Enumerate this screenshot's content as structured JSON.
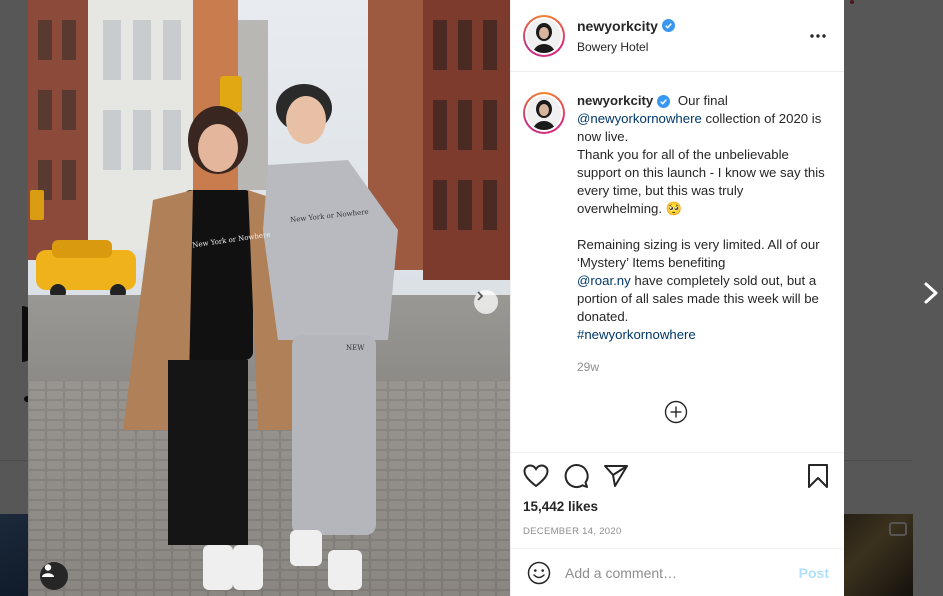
{
  "post": {
    "username": "newyorkcity",
    "location": "Bowery Hotel",
    "caption": {
      "intro": "Our final",
      "mention1": "@newyorkornowhere",
      "line1_rest": " collection of 2020 is now live.",
      "line2": "Thank you for all of the unbelievable support on this launch - I know we say this every time, but this was truly overwhelming. 🥺",
      "para2_start": "Remaining sizing is very limited. All of our ‘Mystery’ Items benefiting",
      "mention2": "@roar.ny",
      "para2_rest": " have completely sold out, but a portion of all sales made this week will be donated.",
      "hashtag": "#newyorkornowhere"
    },
    "time_ago": "29w",
    "likes": "15,442 likes",
    "date": "DECEMBER 14, 2020"
  },
  "comment_box": {
    "placeholder": "Add a comment…",
    "post_label": "Post"
  },
  "photo_text": {
    "sweatshirt_left": "New York or Nowhere",
    "hoodie_right": "New York or Nowhere",
    "pants_logo": "NEW"
  },
  "icons": {
    "heart": "heart-icon",
    "comment": "comment-icon",
    "share": "paper-plane-icon",
    "save": "bookmark-icon",
    "more": "more-options-icon",
    "emoji": "emoji-icon",
    "load_more": "plus-circle-icon",
    "tag": "user-tag-icon",
    "verified": "verified-badge-icon"
  },
  "colors": {
    "link": "#00376b",
    "verified": "#3897f0",
    "post_disabled": "#b2dffc",
    "secondary_text": "#8e8e8e"
  }
}
